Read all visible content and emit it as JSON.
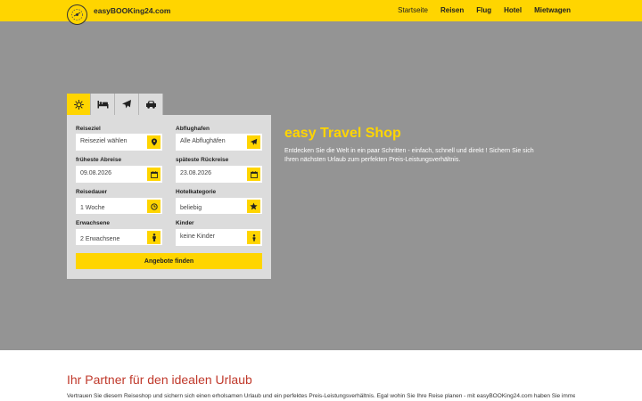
{
  "header": {
    "brand": "easyBOOKing24.com",
    "nav": [
      {
        "label": "Startseite"
      },
      {
        "label": "Reisen"
      },
      {
        "label": "Flug"
      },
      {
        "label": "Hotel"
      },
      {
        "label": "Mietwagen"
      }
    ]
  },
  "search": {
    "tab_icons": [
      "sun-icon",
      "bed-icon",
      "plane-icon",
      "car-icon"
    ],
    "fields": {
      "destination": {
        "label": "Reiseziel",
        "value": "Reiseziel wählen",
        "icon": "map-pin-icon"
      },
      "departure_airport": {
        "label": "Abflughafen",
        "value": "Alle Abflughäfen",
        "icon": "plane-icon"
      },
      "earliest_departure": {
        "label": "früheste Abreise",
        "value": "09.08.2026",
        "icon": "calendar-icon"
      },
      "latest_return": {
        "label": "späteste Rückreise",
        "value": "23.08.2026",
        "icon": "calendar-icon"
      },
      "duration": {
        "label": "Reisedauer",
        "value": "1 Woche",
        "icon": "clock-icon"
      },
      "hotel_category": {
        "label": "Hotelkategorie",
        "value": "beliebig",
        "icon": "star-icon"
      },
      "adults": {
        "label": "Erwachsene",
        "value": "2 Erwachsene",
        "icon": "person-icon"
      },
      "children": {
        "label": "Kinder",
        "value": "keine Kinder",
        "icon": "child-icon"
      }
    },
    "submit_label": "Angebote finden"
  },
  "hero": {
    "title": "easy Travel Shop",
    "text": "Entdecken Sie die Welt in ein paar Schritten - einfach, schnell und direkt ! Sichern Sie sich Ihren nächsten Urlaub zum perfekten Preis-Leistungsverhältnis."
  },
  "content": {
    "title": "Ihr Partner für den idealen Urlaub",
    "text": "Vertrauen Sie diesem Reiseshop und sichern sich einen erholsamen Urlaub und ein perfektes Preis-Leistungsverhältnis. Egal wohin Sie Ihre Reise planen - mit easyBOOKing24.com haben Sie immer einen"
  },
  "colors": {
    "accent": "#ffd500",
    "hero_bg": "#949494",
    "panel_bg": "#dcdcdc",
    "section_title": "#c0392b"
  }
}
